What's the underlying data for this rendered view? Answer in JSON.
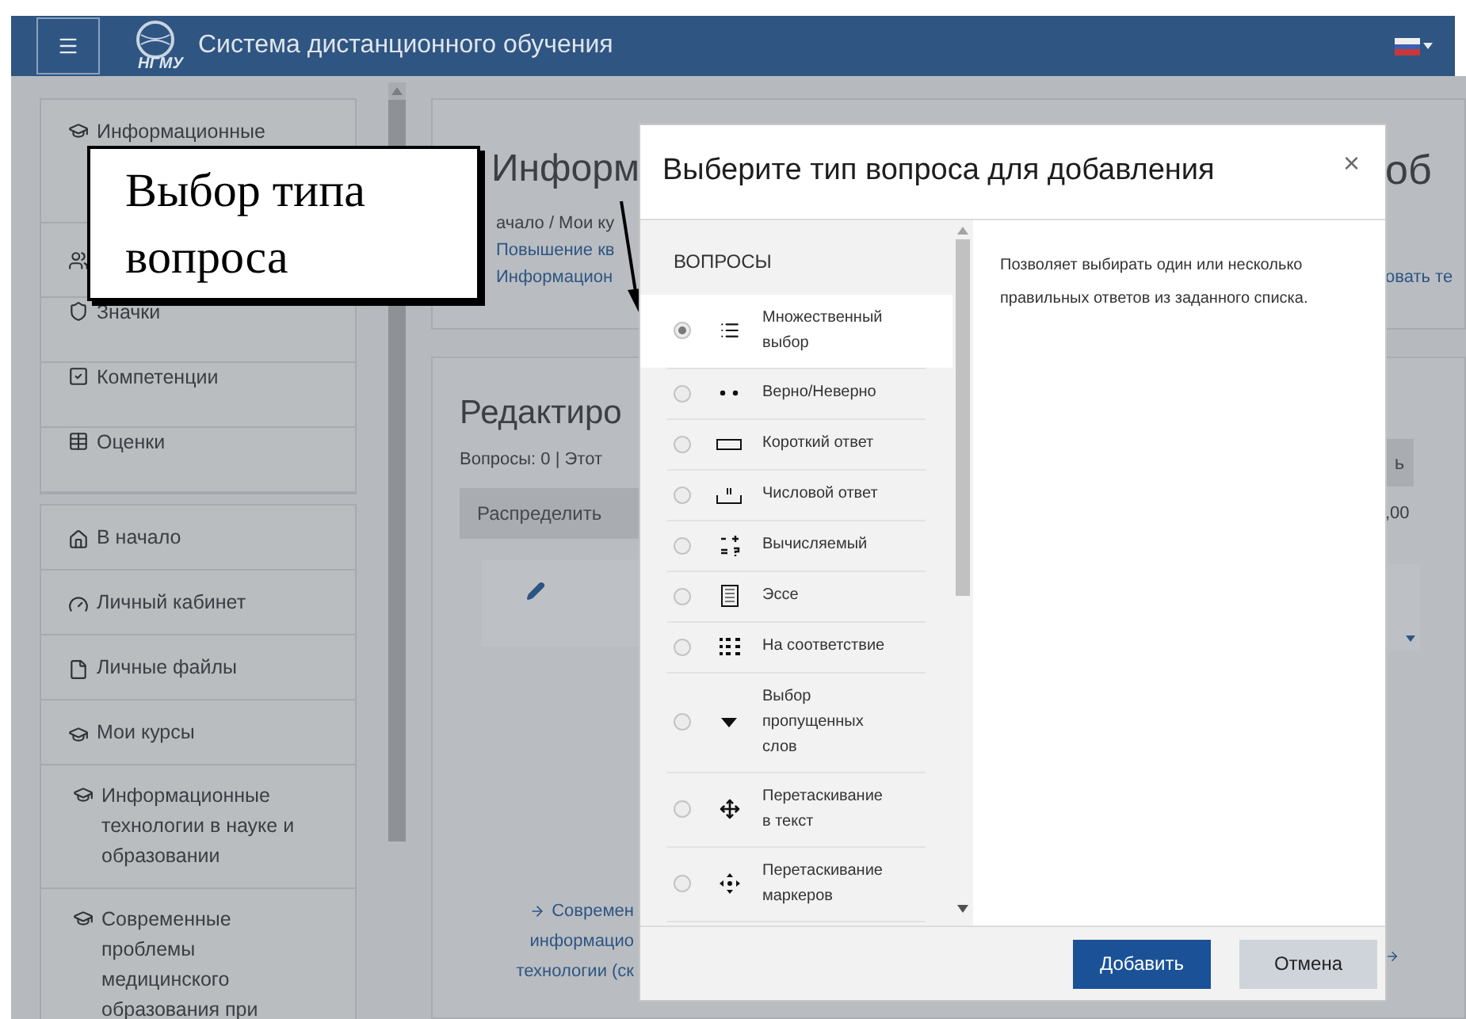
{
  "navbar": {
    "logo_text": "НГМУ",
    "title": "Система дистанционного обучения"
  },
  "sidebar": {
    "groups": [
      [
        {
          "label": "Информационные"
        },
        {
          "label": "Значки"
        },
        {
          "label": "Компетенции"
        },
        {
          "label": "Оценки"
        }
      ],
      [
        {
          "label": "В начало"
        },
        {
          "label": "Личный кабинет"
        },
        {
          "label": "Личные файлы"
        },
        {
          "label": "Мои курсы"
        },
        {
          "label": "Информационные технологии в науке и образовании"
        },
        {
          "label": "Современные проблемы медицинского образования при"
        }
      ]
    ]
  },
  "header_card": {
    "title_left": "Информ",
    "title_right": "об",
    "breadcrumbs": [
      "ачало / Мои ку",
      "Повышение кв",
      "Информацион"
    ],
    "right_link": "овать те"
  },
  "edit_card": {
    "heading": "Редактиро",
    "summary": "Вопросы: 0 | Этот",
    "button": "Распределить",
    "right_button": "ь",
    "right_text": ",00",
    "bottom_link": [
      "Современ",
      "информацио",
      "технологии (ск"
    ]
  },
  "modal": {
    "title": "Выберите тип вопроса для добавления",
    "close": "×",
    "list_header": "ВОПРОСЫ",
    "question_types": [
      {
        "label": "Множественный выбор",
        "selected": true
      },
      {
        "label": "Верно/Неверно",
        "selected": false
      },
      {
        "label": "Короткий ответ",
        "selected": false
      },
      {
        "label": "Числовой ответ",
        "selected": false
      },
      {
        "label": "Вычисляемый",
        "selected": false
      },
      {
        "label": "Эссе",
        "selected": false
      },
      {
        "label": "На соответствие",
        "selected": false
      },
      {
        "label": "Выбор пропущенных слов",
        "selected": false
      },
      {
        "label": "Перетаскивание в текст",
        "selected": false
      },
      {
        "label": "Перетаскивание маркеров",
        "selected": false
      }
    ],
    "description": "Позволяет выбирать один или несколько правильных ответов из заданного списка.",
    "buttons": [
      "Добавить",
      "Отмена"
    ]
  },
  "callout": {
    "text": "Выбор типа вопроса"
  }
}
